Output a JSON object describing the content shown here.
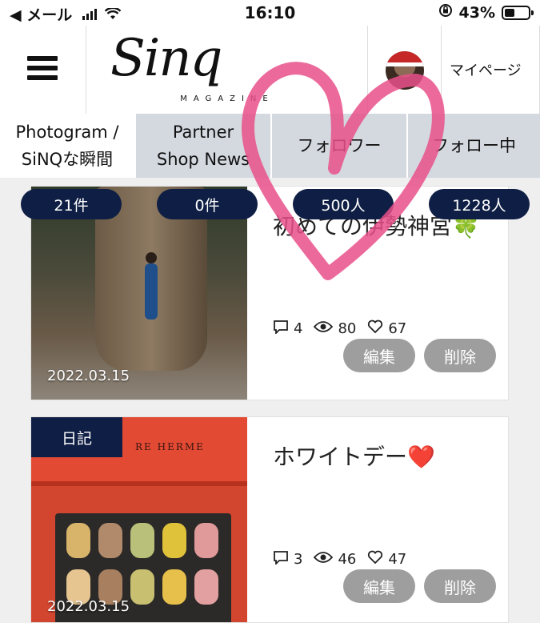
{
  "status_bar": {
    "back_app": "◀ メール",
    "time": "16:10",
    "battery_percent": "43%",
    "battery_level": 0.43
  },
  "header": {
    "logo": "Sinq",
    "logo_tagline": "MAGAZINE",
    "mypage_label": "マイページ"
  },
  "tabs": [
    {
      "label_line1": "Photogram /",
      "label_line2": "SiNQな瞬間",
      "active": true
    },
    {
      "label_line1": "Partner",
      "label_line2": "Shop News",
      "active": false
    },
    {
      "label_line1": "フォロワー",
      "label_line2": "",
      "active": false
    },
    {
      "label_line1": "フォロー中",
      "label_line2": "",
      "active": false
    }
  ],
  "counts": [
    "21件",
    "0件",
    "500人",
    "1228人"
  ],
  "posts": [
    {
      "title": "初めての伊勢神宮🍀",
      "date": "2022.03.15",
      "category": "",
      "comments": "4",
      "views": "80",
      "likes": "67",
      "edit_label": "編集",
      "delete_label": "削除"
    },
    {
      "title": "ホワイトデー❤️",
      "date": "2022.03.15",
      "category": "日記",
      "brand_text": "RE HERME",
      "comments": "3",
      "views": "46",
      "likes": "47",
      "edit_label": "編集",
      "delete_label": "削除"
    }
  ],
  "colors": {
    "navy": "#0f1e44",
    "tab_inactive": "#d4d9e0",
    "button_gray": "#9e9e9e",
    "heart_pink": "#e8508a"
  }
}
